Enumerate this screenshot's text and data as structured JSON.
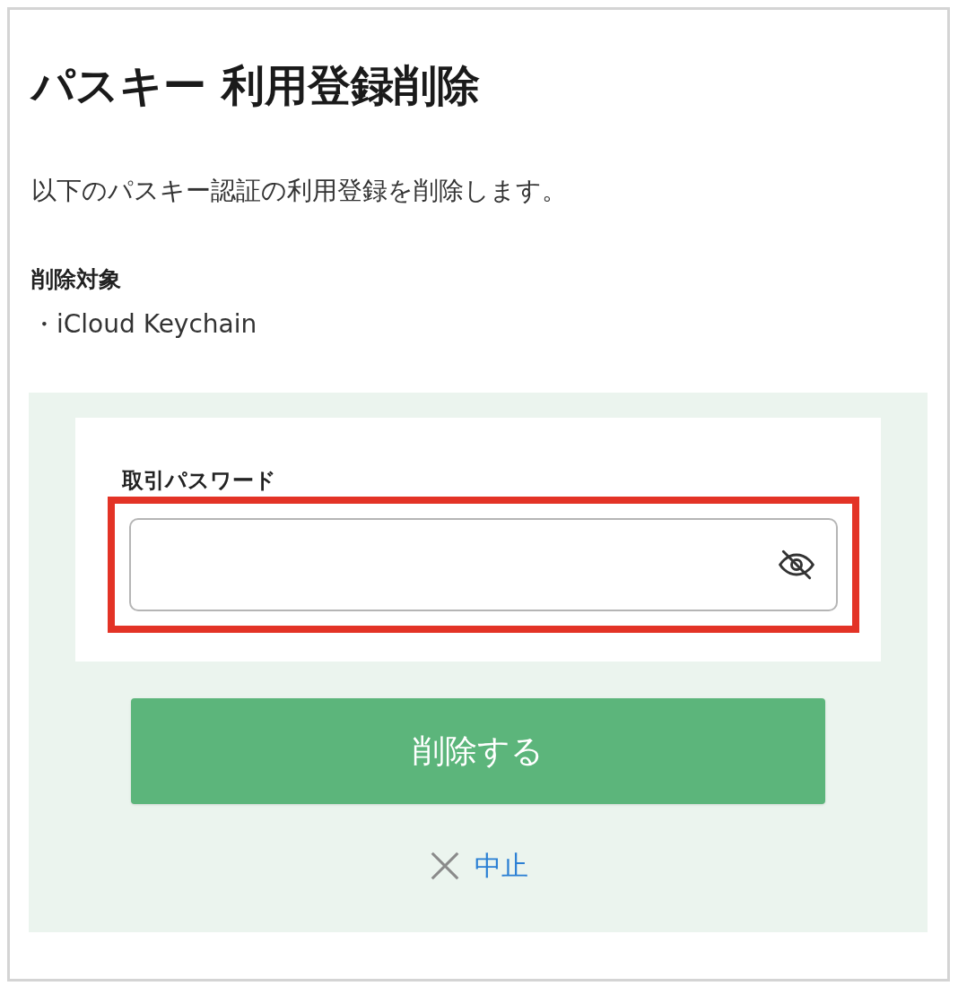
{
  "title": "パスキー 利用登録削除",
  "description": "以下のパスキー認証の利用登録を削除します。",
  "target": {
    "label": "削除対象",
    "items": [
      "・iCloud Keychain"
    ]
  },
  "password": {
    "label": "取引パスワード",
    "highlighted": true
  },
  "submit_button": "削除する",
  "cancel_link": "中止"
}
